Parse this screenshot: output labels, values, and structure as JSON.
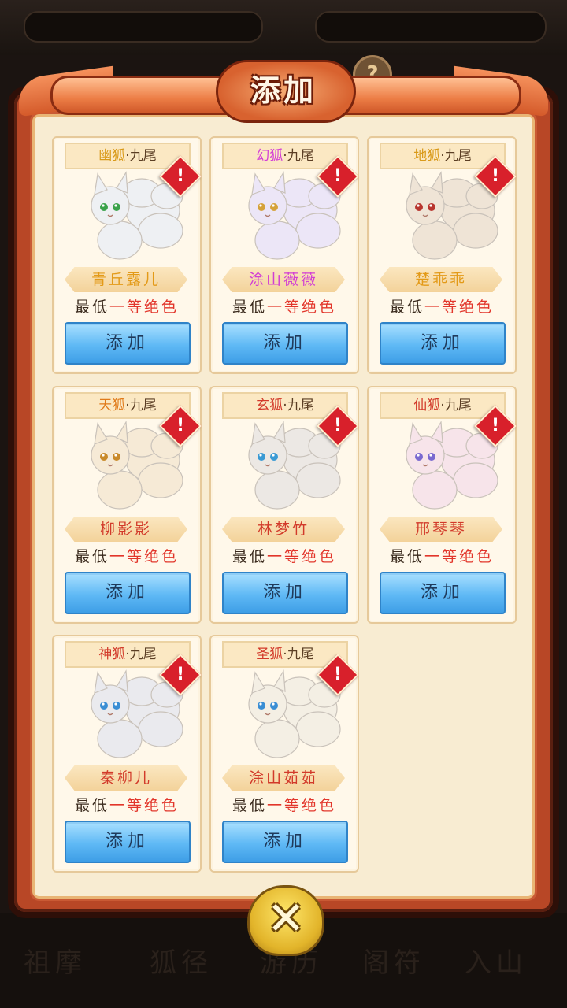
{
  "dialog": {
    "title": "添加"
  },
  "background": {
    "bottom_text": [
      "祖摩",
      "狐径",
      "游历",
      "阁符",
      "入山"
    ]
  },
  "cards": [
    {
      "type_prefix": "幽狐",
      "type_suffix": "·九尾",
      "type_color": "#d99a1a",
      "name": "青丘露儿",
      "name_color": "#e39a18",
      "req_prefix": "最低",
      "req_rank": "一等绝色",
      "button": "添加",
      "alert": "!",
      "fox_tint": "#eef0f3",
      "eye": "#3aa24a"
    },
    {
      "type_prefix": "幻狐",
      "type_suffix": "·九尾",
      "type_color": "#d43fd6",
      "name": "涂山薇薇",
      "name_color": "#d23fd3",
      "req_prefix": "最低",
      "req_rank": "一等绝色",
      "button": "添加",
      "alert": "!",
      "fox_tint": "#ece6f7",
      "eye": "#d5a23a"
    },
    {
      "type_prefix": "地狐",
      "type_suffix": "·九尾",
      "type_color": "#d99a1a",
      "name": "楚乖乖",
      "name_color": "#e39a18",
      "req_prefix": "最低",
      "req_rank": "一等绝色",
      "button": "添加",
      "alert": "!",
      "fox_tint": "#efe4d6",
      "eye": "#b8352e"
    },
    {
      "type_prefix": "天狐",
      "type_suffix": "·九尾",
      "type_color": "#e07a1a",
      "name": "柳影影",
      "name_color": "#d23a2a",
      "req_prefix": "最低",
      "req_rank": "一等绝色",
      "button": "添加",
      "alert": "!",
      "fox_tint": "#f6ead6",
      "eye": "#c98a2a"
    },
    {
      "type_prefix": "玄狐",
      "type_suffix": "·九尾",
      "type_color": "#d23a2a",
      "name": "林梦竹",
      "name_color": "#d23a2a",
      "req_prefix": "最低",
      "req_rank": "一等绝色",
      "button": "添加",
      "alert": "!",
      "fox_tint": "#ece8e4",
      "eye": "#3a9ad4"
    },
    {
      "type_prefix": "仙狐",
      "type_suffix": "·九尾",
      "type_color": "#d23a2a",
      "name": "邢琴琴",
      "name_color": "#d23a2a",
      "req_prefix": "最低",
      "req_rank": "一等绝色",
      "button": "添加",
      "alert": "!",
      "fox_tint": "#f7e4ea",
      "eye": "#7a6ad0"
    },
    {
      "type_prefix": "神狐",
      "type_suffix": "·九尾",
      "type_color": "#d23a2a",
      "name": "秦柳儿",
      "name_color": "#d23a2a",
      "req_prefix": "最低",
      "req_rank": "一等绝色",
      "button": "添加",
      "alert": "!",
      "fox_tint": "#eaeaee",
      "eye": "#3a8ed4"
    },
    {
      "type_prefix": "圣狐",
      "type_suffix": "·九尾",
      "type_color": "#d23a2a",
      "name": "涂山茹茹",
      "name_color": "#d23a2a",
      "req_prefix": "最低",
      "req_rank": "一等绝色",
      "button": "添加",
      "alert": "!",
      "fox_tint": "#f4efe4",
      "eye": "#3a8ed4"
    }
  ],
  "close_button": "✕",
  "help_button": "?"
}
